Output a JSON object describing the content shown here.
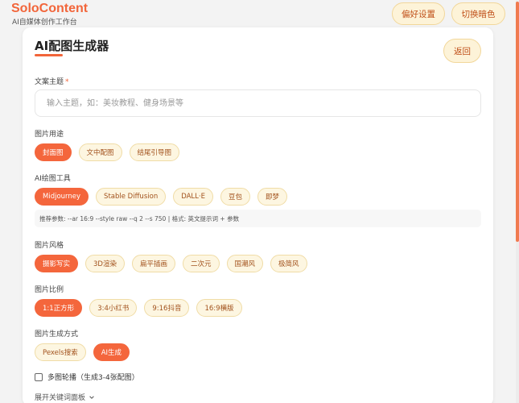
{
  "header": {
    "brand_title": "SoloContent",
    "brand_subtitle": "AI自媒体创作工作台",
    "preferences_label": "偏好设置",
    "theme_toggle_label": "切换暗色"
  },
  "card": {
    "title": "AI配图生成器",
    "back_label": "返回"
  },
  "topic": {
    "label": "文案主题",
    "required_mark": "*",
    "placeholder": "输入主题，如：美妆教程、健身场景等",
    "value": ""
  },
  "usage": {
    "label": "图片用途",
    "options": [
      "封面图",
      "文中配图",
      "结尾引导图"
    ],
    "selected": "封面图"
  },
  "tool": {
    "label": "AI绘图工具",
    "options": [
      "Midjourney",
      "Stable Diffusion",
      "DALL·E",
      "豆包",
      "即梦"
    ],
    "selected": "Midjourney",
    "hint": "推荐参数: --ar 16:9 --style raw --q 2 --s 750  |  格式: 英文提示词 + 参数"
  },
  "style": {
    "label": "图片风格",
    "options": [
      "摄影写实",
      "3D渲染",
      "扁平插画",
      "二次元",
      "国潮风",
      "极简风"
    ],
    "selected": "摄影写实"
  },
  "ratio": {
    "label": "图片比例",
    "options": [
      "1:1正方形",
      "3:4小红书",
      "9:16抖音",
      "16:9横版"
    ],
    "selected": "1:1正方形"
  },
  "method": {
    "label": "图片生成方式",
    "options": [
      "Pexels搜索",
      "AI生成"
    ],
    "selected": "AI生成"
  },
  "multi": {
    "label": "多图轮播（生成3-4张配图）",
    "checked": false
  },
  "expand": {
    "label": "展开关键词面板"
  },
  "colors": {
    "accent": "#f4663c",
    "chip_bg": "#fdf6e1",
    "chip_text": "#a2521d"
  }
}
